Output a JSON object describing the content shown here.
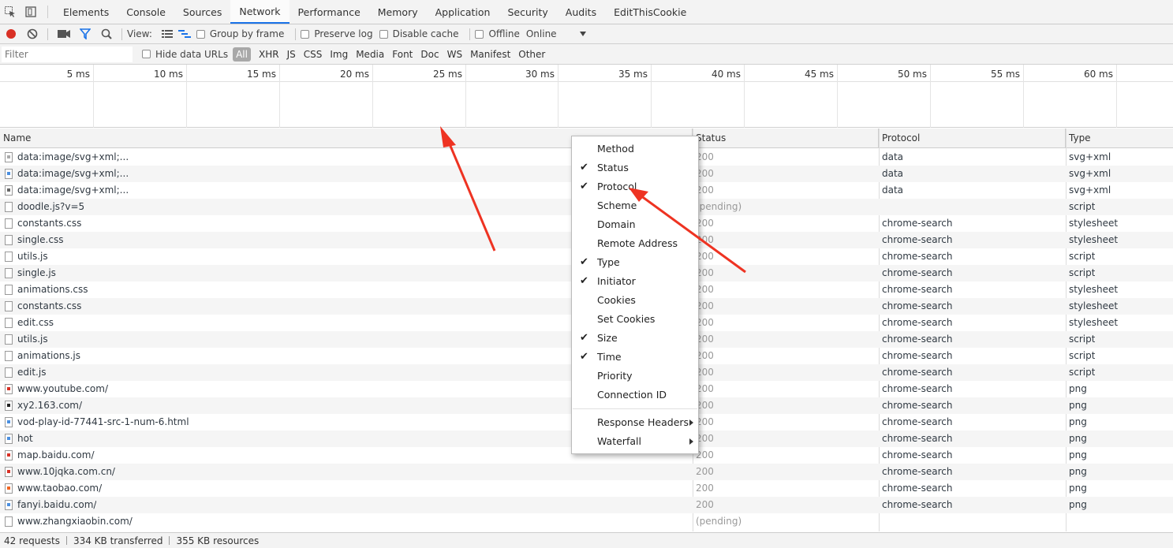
{
  "tabs": [
    "Elements",
    "Console",
    "Sources",
    "Network",
    "Performance",
    "Memory",
    "Application",
    "Security",
    "Audits",
    "EditThisCookie"
  ],
  "active_tab": "Network",
  "toolbar": {
    "view_label": "View:",
    "group_by_frame": "Group by frame",
    "preserve_log": "Preserve log",
    "disable_cache": "Disable cache",
    "offline": "Offline",
    "throttle": "Online"
  },
  "filter": {
    "placeholder": "Filter",
    "hide_data_urls": "Hide data URLs",
    "types": [
      "All",
      "XHR",
      "JS",
      "CSS",
      "Img",
      "Media",
      "Font",
      "Doc",
      "WS",
      "Manifest",
      "Other"
    ]
  },
  "overview": {
    "ticks": [
      "5 ms",
      "10 ms",
      "15 ms",
      "20 ms",
      "25 ms",
      "30 ms",
      "35 ms",
      "40 ms",
      "45 ms",
      "50 ms",
      "55 ms",
      "60 ms"
    ]
  },
  "columns": {
    "name": "Name",
    "status": "Status",
    "protocol": "Protocol",
    "type": "Type"
  },
  "rows": [
    {
      "name": "data:image/svg+xml;...",
      "status": "200",
      "protocol": "data",
      "type": "svg+xml",
      "icon": "svg-gray"
    },
    {
      "name": "data:image/svg+xml;...",
      "status": "200",
      "protocol": "data",
      "type": "svg+xml",
      "icon": "svg-blue"
    },
    {
      "name": "data:image/svg+xml;...",
      "status": "200",
      "protocol": "data",
      "type": "svg+xml",
      "icon": "svg-gear"
    },
    {
      "name": "doodle.js?v=5",
      "status": "(pending)",
      "protocol": "",
      "type": "script",
      "icon": "file"
    },
    {
      "name": "constants.css",
      "status": "200",
      "protocol": "chrome-search",
      "type": "stylesheet",
      "icon": "file"
    },
    {
      "name": "single.css",
      "status": "200",
      "protocol": "chrome-search",
      "type": "stylesheet",
      "icon": "file"
    },
    {
      "name": "utils.js",
      "status": "200",
      "protocol": "chrome-search",
      "type": "script",
      "icon": "file"
    },
    {
      "name": "single.js",
      "status": "200",
      "protocol": "chrome-search",
      "type": "script",
      "icon": "file"
    },
    {
      "name": "animations.css",
      "status": "200",
      "protocol": "chrome-search",
      "type": "stylesheet",
      "icon": "file"
    },
    {
      "name": "constants.css",
      "status": "200",
      "protocol": "chrome-search",
      "type": "stylesheet",
      "icon": "file"
    },
    {
      "name": "edit.css",
      "status": "200",
      "protocol": "chrome-search",
      "type": "stylesheet",
      "icon": "file"
    },
    {
      "name": "utils.js",
      "status": "200",
      "protocol": "chrome-search",
      "type": "script",
      "icon": "file"
    },
    {
      "name": "animations.js",
      "status": "200",
      "protocol": "chrome-search",
      "type": "script",
      "icon": "file"
    },
    {
      "name": "edit.js",
      "status": "200",
      "protocol": "chrome-search",
      "type": "script",
      "icon": "file"
    },
    {
      "name": "www.youtube.com/",
      "status": "200",
      "protocol": "chrome-search",
      "type": "png",
      "icon": "img-red"
    },
    {
      "name": "xy2.163.com/",
      "status": "200",
      "protocol": "chrome-search",
      "type": "png",
      "icon": "img-black"
    },
    {
      "name": "vod-play-id-77441-src-1-num-6.html",
      "status": "200",
      "protocol": "chrome-search",
      "type": "png",
      "icon": "img-blue"
    },
    {
      "name": "hot",
      "status": "200",
      "protocol": "chrome-search",
      "type": "png",
      "icon": "img-blue"
    },
    {
      "name": "map.baidu.com/",
      "status": "200",
      "protocol": "chrome-search",
      "type": "png",
      "icon": "img-red"
    },
    {
      "name": "www.10jqka.com.cn/",
      "status": "200",
      "protocol": "chrome-search",
      "type": "png",
      "icon": "img-red"
    },
    {
      "name": "www.taobao.com/",
      "status": "200",
      "protocol": "chrome-search",
      "type": "png",
      "icon": "img-orange"
    },
    {
      "name": "fanyi.baidu.com/",
      "status": "200",
      "protocol": "chrome-search",
      "type": "png",
      "icon": "img-blue"
    },
    {
      "name": "www.zhangxiaobin.com/",
      "status": "(pending)",
      "protocol": "",
      "type": "",
      "icon": "file"
    }
  ],
  "status_bar": {
    "requests": "42 requests",
    "transferred": "334 KB transferred",
    "resources": "355 KB resources"
  },
  "context_menu": {
    "items": [
      {
        "label": "Method",
        "checked": false
      },
      {
        "label": "Status",
        "checked": true
      },
      {
        "label": "Protocol",
        "checked": true
      },
      {
        "label": "Scheme",
        "checked": false
      },
      {
        "label": "Domain",
        "checked": false
      },
      {
        "label": "Remote Address",
        "checked": false
      },
      {
        "label": "Type",
        "checked": true
      },
      {
        "label": "Initiator",
        "checked": true
      },
      {
        "label": "Cookies",
        "checked": false
      },
      {
        "label": "Set Cookies",
        "checked": false
      },
      {
        "label": "Size",
        "checked": true
      },
      {
        "label": "Time",
        "checked": true
      },
      {
        "label": "Priority",
        "checked": false
      },
      {
        "label": "Connection ID",
        "checked": false
      }
    ],
    "submenus": [
      "Response Headers",
      "Waterfall"
    ]
  },
  "colors": {
    "record": "#d93025",
    "accent": "#1a73e8",
    "annotation_arrow": "#ee3322"
  }
}
